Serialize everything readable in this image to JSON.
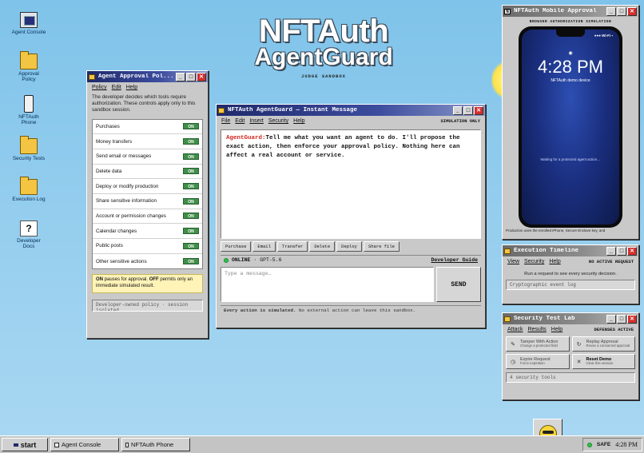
{
  "desktop": {
    "icons": [
      {
        "label": "Agent Console",
        "icon": "console-monitor-icon"
      },
      {
        "label": "Approval Policy",
        "icon": "folder-icon"
      },
      {
        "label": "NFTAuth Phone",
        "icon": "phone-icon"
      },
      {
        "label": "Security Tests",
        "icon": "folder-icon"
      },
      {
        "label": "Execution Log",
        "icon": "folder-icon"
      },
      {
        "label": "Developer Docs",
        "icon": "help-icon"
      }
    ]
  },
  "hero": {
    "title_line1": "NFTAuth",
    "title_line2": "AgentGuard",
    "subtitle": "JUDGE SANDBOX"
  },
  "approval_window": {
    "title": "Agent Approval Pol...",
    "menu": [
      "Policy",
      "Edit",
      "Help"
    ],
    "description": "The developer decides which tools require authorization. These controls apply only to this sandbox session.",
    "tools": [
      {
        "name": "Purchases",
        "state": "ON"
      },
      {
        "name": "Money transfers",
        "state": "ON"
      },
      {
        "name": "Send email or messages",
        "state": "ON"
      },
      {
        "name": "Delete data",
        "state": "ON"
      },
      {
        "name": "Deploy or modify production",
        "state": "ON"
      },
      {
        "name": "Share sensitive information",
        "state": "ON"
      },
      {
        "name": "Account or permission changes",
        "state": "ON"
      },
      {
        "name": "Calendar changes",
        "state": "ON"
      },
      {
        "name": "Public posts",
        "state": "ON"
      },
      {
        "name": "Other sensitive actions",
        "state": "ON"
      }
    ],
    "note_on": "ON",
    "note_mid": " pauses for approval. ",
    "note_off": "OFF",
    "note_rest": " permits only an immediate simulated result.",
    "status": "Developer-owned policy · session isolated"
  },
  "im_window": {
    "title": "NFTAuth AgentGuard — Instant Message",
    "menu": [
      "File",
      "Edit",
      "Insert",
      "Security",
      "Help"
    ],
    "mode": "SIMULATION ONLY",
    "message_sender": "AgentGuard:",
    "message_text": "Tell me what you want an agent to do. I'll propose the exact action, then enforce your approval policy. Nothing here can affect a real account or service.",
    "quick_actions": [
      "Purchase",
      "Email",
      "Transfer",
      "Delete",
      "Deploy",
      "Share file"
    ],
    "status_online": "ONLINE",
    "status_model": "· GPT-5.6",
    "guide_link": "Developer Guide",
    "input_placeholder": "Type a message…",
    "send_label": "SEND",
    "footer_bold": "Every action is simulated.",
    "footer_rest": " No external action can leave this sandbox."
  },
  "mobile_window": {
    "title": "NFTAuth Mobile Approval",
    "caption": "BROWSER AUTHORIZATION SIMULATION",
    "wifi": "●●● Wi-Fi ▪",
    "lock_icon": "lock-icon",
    "time": "4:28 PM",
    "device": "NFTAuth demo device",
    "waiting": "Waiting for a protected agent action…",
    "footer": "Production uses the enrolled iPhone, Secure Enclave key, and"
  },
  "timeline_window": {
    "title": "Execution Timeline",
    "menu": [
      "View",
      "Security",
      "Help"
    ],
    "state": "NO ACTIVE REQUEST",
    "message": "Run a request to see every security decision.",
    "status": "Cryptographic event log"
  },
  "lab_window": {
    "title": "Security Test Lab",
    "menu": [
      "Attack",
      "Results",
      "Help"
    ],
    "state": "DEFENSES ACTIVE",
    "tests": [
      {
        "icon": "pencil-icon",
        "glyph": "✎",
        "title": "Tamper With Action",
        "sub": "Change a protected field",
        "strong": false
      },
      {
        "icon": "replay-icon",
        "glyph": "↻",
        "title": "Replay Approval",
        "sub": "Reuse a consumed approval",
        "strong": false
      },
      {
        "icon": "clock-icon",
        "glyph": "◷",
        "title": "Expire Request",
        "sub": "Force expiration",
        "strong": false
      },
      {
        "icon": "reset-x-icon",
        "glyph": "✕",
        "title": "Reset Demo",
        "sub": "Clear this session",
        "strong": true
      }
    ],
    "status": "4 security tools"
  },
  "taskbar": {
    "start": "start",
    "tasks": [
      {
        "label": "Agent Console",
        "icon": "console-icon"
      },
      {
        "label": "NFTAuth Phone",
        "icon": "phone-icon"
      }
    ],
    "tray_status": "SAFE",
    "clock": "4:28 PM"
  },
  "colors": {
    "desktop_bg": "#9ad0ef",
    "titlebar_active": "#1f2a6b",
    "toggle_on": "#3f8e48",
    "sender_red": "#d1261f",
    "online_green": "#2ec24a"
  }
}
